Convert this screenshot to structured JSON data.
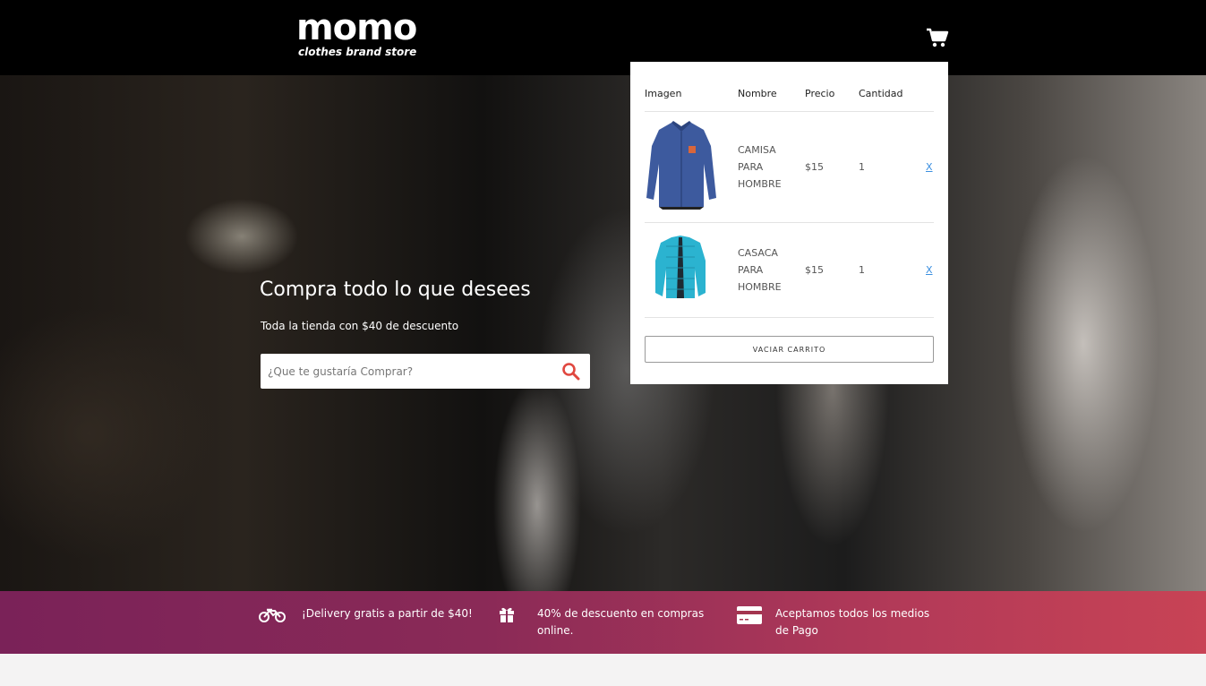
{
  "brand": {
    "name": "momo",
    "tagline": "clothes brand store"
  },
  "header": {
    "cart_icon": "shopping-cart-icon"
  },
  "hero": {
    "title": "Compra todo lo que desees",
    "subtitle": "Toda la tienda con $40 de descuento",
    "search_placeholder": "¿Que te gustaría Comprar?",
    "search_icon": "search-icon"
  },
  "cart": {
    "headers": {
      "image": "Imagen",
      "name": "Nombre",
      "price": "Precio",
      "quantity": "Cantidad"
    },
    "items": [
      {
        "name": "Camisa para hombre",
        "price": "$15",
        "quantity": "1",
        "remove": "X",
        "colors": {
          "main": "#3d5a9e"
        }
      },
      {
        "name": "Casaca para hombre",
        "price": "$15",
        "quantity": "1",
        "remove": "X",
        "colors": {
          "main": "#2bb3d0"
        }
      }
    ],
    "empty_button": "VACIAR CARRITO"
  },
  "features": [
    {
      "icon": "motorcycle-icon",
      "text": "¡Delivery gratis a partir de $40!"
    },
    {
      "icon": "gift-icon",
      "text": "40% de descuento en compras online."
    },
    {
      "icon": "credit-card-icon",
      "text": "Aceptamos todos los medios de Pago"
    }
  ],
  "colors": {
    "header": "#000000",
    "feature_start": "#7a2258",
    "feature_end": "#c84355",
    "search_accent": "#e0473f",
    "link": "#3b8fe0"
  }
}
